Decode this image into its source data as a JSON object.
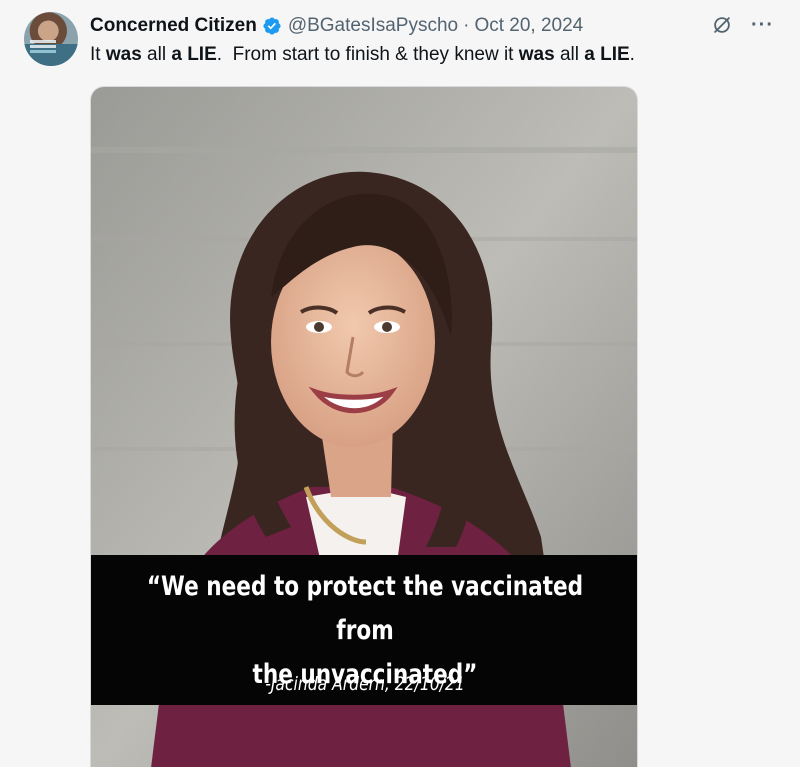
{
  "post": {
    "author_name": "Concerned Citizen",
    "handle": "@BGatesIsaPyscho",
    "separator": "·",
    "date": "Oct 20, 2024",
    "verified": true,
    "text_segments": [
      {
        "text": "It ",
        "bold": false
      },
      {
        "text": "was",
        "bold": true
      },
      {
        "text": " all ",
        "bold": false
      },
      {
        "text": "a LIE",
        "bold": true
      },
      {
        "text": ".  From start to finish & they knew it ",
        "bold": false
      },
      {
        "text": "was",
        "bold": true
      },
      {
        "text": " all ",
        "bold": false
      },
      {
        "text": "a LIE",
        "bold": true
      },
      {
        "text": ".",
        "bold": false
      }
    ]
  },
  "media": {
    "quote_line1": "“We need to protect the vaccinated from",
    "quote_line2": "the unvaccinated”",
    "attribution": "-Jacinda Ardern, 22/10/21"
  },
  "icons": {
    "verified": "verified-badge-icon",
    "grok": "grok-icon",
    "more": "more-options-icon"
  },
  "colors": {
    "background": "#f6f6f6",
    "text_primary": "#0f1419",
    "text_secondary": "#536471",
    "verified_blue": "#1d9bf0",
    "jacket": "#6e2140",
    "caption_band": "#050505"
  }
}
